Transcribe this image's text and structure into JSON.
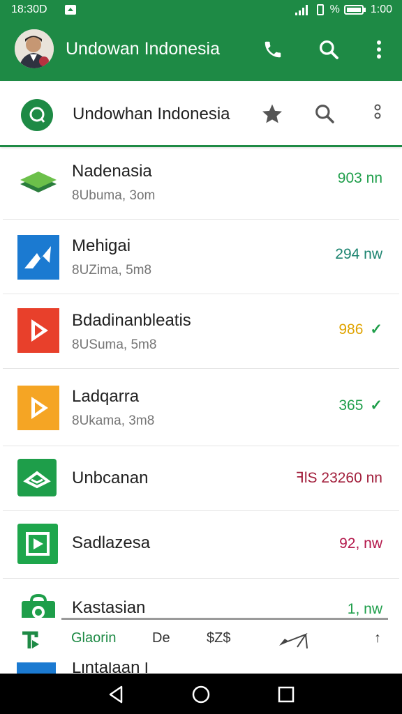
{
  "status": {
    "time": "18:30D",
    "right": "1:00",
    "battery_pct": "%"
  },
  "header": {
    "title": "Undowan Indonesia"
  },
  "chat_header": {
    "title": "Undowhan Indonesia"
  },
  "rows": [
    {
      "name": "Nadenasia",
      "sub": "8Ubuma, 3om",
      "meta": "903  nn",
      "meta_color": "#1e9e4a",
      "icon": "green-layers-icon"
    },
    {
      "name": "Mehigai",
      "sub": "8UZima, 5m8",
      "meta": "294  nw",
      "meta_color": "#1d8470",
      "icon": "blue-arrow-icon"
    },
    {
      "name": "Bdadinanbleatis",
      "sub": "8USuma, 5m8",
      "meta": "986",
      "meta_color": "#e0a300",
      "check": "✓",
      "icon": "red-play-icon"
    },
    {
      "name": "Ladqarra",
      "sub": "8Ukama, 3m8",
      "meta": "365",
      "meta_color": "#1e9e4a",
      "check": "✓",
      "icon": "orange-play-icon"
    },
    {
      "name": "Unbcanan",
      "meta": "ꟻlS 23260  nn",
      "meta_color": "#a11d3a",
      "icon": "green-mail-icon"
    },
    {
      "name": "Sadlazesa",
      "meta": "92, nw",
      "meta_color": "#b3174a",
      "icon": "green-video-icon"
    },
    {
      "name": "Kastasian",
      "meta": "1, nw",
      "meta_color": "#1e9e4a",
      "icon": "green-bag-icon"
    }
  ],
  "tabs": {
    "t1": "Glaorin",
    "t2": "De",
    "t3": "$Z$",
    "t4": "↑"
  },
  "peek_label": "Lintalaan l"
}
